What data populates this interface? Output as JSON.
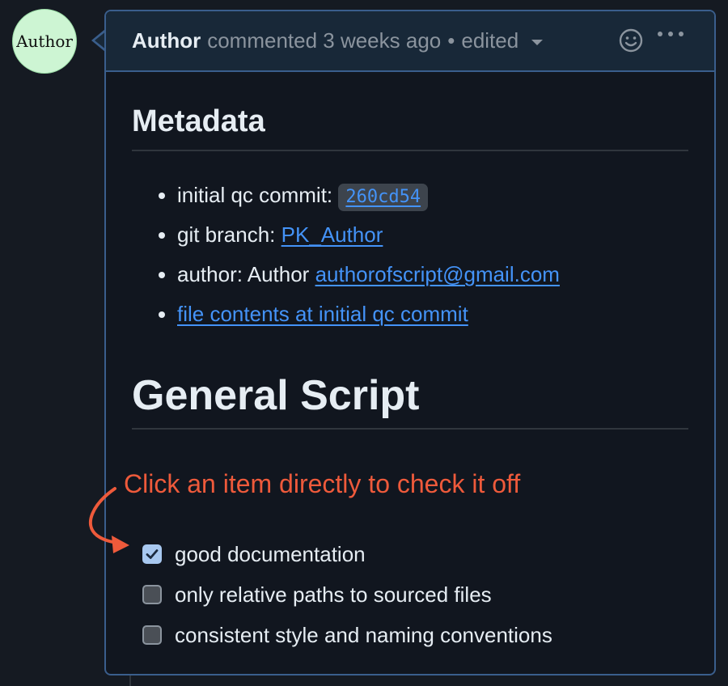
{
  "avatar": {
    "label": "Author"
  },
  "comment": {
    "author": "Author",
    "action": "commented 3 weeks ago",
    "separator": "•",
    "edited": "edited"
  },
  "metadata": {
    "heading": "Metadata",
    "items": [
      {
        "prefix": "initial qc commit: ",
        "code": "260cd54"
      },
      {
        "prefix": "git branch: ",
        "link": "PK_Author"
      },
      {
        "prefix": "author: Author ",
        "link": "authorofscript@gmail.com"
      },
      {
        "prefix": "",
        "link": "file contents at initial qc commit"
      }
    ]
  },
  "general": {
    "heading": "General Script"
  },
  "annotation": {
    "text": "Click an item directly to check it off",
    "color": "#ee5a3b"
  },
  "tasks": [
    {
      "label": "good documentation",
      "checked": true
    },
    {
      "label": "only relative paths to sourced files",
      "checked": false
    },
    {
      "label": "consistent style and naming conventions",
      "checked": false
    }
  ],
  "icons": {
    "emoji": "smiley-icon",
    "more": "kebab-horizontal-icon",
    "dropdown": "triangle-down-icon",
    "check": "checkmark-icon"
  },
  "colors": {
    "link": "#4493f8",
    "header_bg": "#182838",
    "border": "#3a5e8c"
  }
}
